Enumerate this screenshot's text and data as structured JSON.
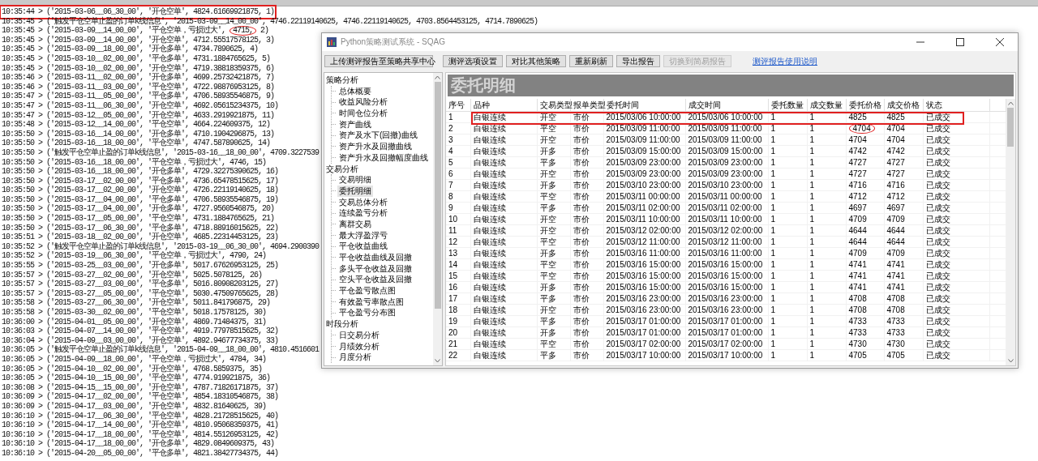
{
  "log_panel": {
    "lines": [
      {
        "text": "10:35:44 > ('2015-03-06__06_30_00', '开仓空单', 4824.61669921875, 1)",
        "highlighted": true
      },
      {
        "text": "10:35:45 > ('触发平仓空单止盈的订单k线信息', '2015-03-09__14_00_00', 4746.22119140625, 4746.22119140625, 4703.8564453125, 4714.7890625)",
        "highlighted": false
      },
      {
        "text": "10:35:45 > ('2015-03-09__14_00_00', '平仓空单，亏损过大', ",
        "circled": "4715,",
        "after": " 2)",
        "highlighted": false
      },
      {
        "text": "10:35:45 > ('2015-03-09__14_00_00', '开仓空单', 4712.55517578125, 3)",
        "highlighted": false
      },
      {
        "text": "10:35:45 > ('2015-03-09__18_00_00', '开仓多单', 4734.7890625, 4)",
        "highlighted": false
      },
      {
        "text": "10:35:45 > ('2015-03-10__02_00_00', '平仓多单', 4731.1884765625, 5)",
        "highlighted": false
      },
      {
        "text": "10:35:45 > ('2015-03-10__02_00_00', '开仓空单', 4719.38818359375, 6)",
        "highlighted": false
      },
      {
        "text": "10:35:46 > ('2015-03-11__02_00_00', '开仓多单', 4699.25732421875, 7)",
        "highlighted": false
      },
      {
        "text": "10:35:46 > ('2015-03-11__03_00_00', '平仓空单', 4722.98876953125, 8)",
        "highlighted": false
      },
      {
        "text": "10:35:47 > ('2015-03-11__05_00_00', '平仓多单', 4706.58935546875, 9)",
        "highlighted": false
      },
      {
        "text": "10:35:47 > ('2015-03-11__06_30_00', '开仓空单', 4692.05615234375, 10)",
        "highlighted": false
      },
      {
        "text": "10:35:47 > ('2015-03-12__05_00_00', '开仓空单', 4633.2919921875, 11)",
        "highlighted": false
      },
      {
        "text": "10:35:48 > ('2015-03-12__14_00_00', '平仓空单', 4664.224609375, 12)",
        "highlighted": false
      },
      {
        "text": "10:35:50 > ('2015-03-16__14_00_00', '开仓多单', 4710.1904296875, 13)",
        "highlighted": false
      },
      {
        "text": "10:35:50 > ('2015-03-16__18_00_00', '平仓空单', 4747.587890625, 14)",
        "highlighted": false
      },
      {
        "text": "10:35:50 > ('触发平仓空单止盈的订单k线信息', '2015-03-16__18_00_00', 4709.3227539",
        "highlighted": false
      },
      {
        "text": "10:35:50 > ('2015-03-16__18_00_00', '平仓空单，亏损过大', 4746, 15)",
        "highlighted": false
      },
      {
        "text": "10:35:50 > ('2015-03-16__18_00_00', '开仓多单', 4729.32275390625, 16)",
        "highlighted": false
      },
      {
        "text": "10:35:50 > ('2015-03-17__02_00_00', '平仓多单', 4736.65478515625, 17)",
        "highlighted": false
      },
      {
        "text": "10:35:50 > ('2015-03-17__02_00_00', '开仓空单', 4726.22119140625, 18)",
        "highlighted": false
      },
      {
        "text": "10:35:50 > ('2015-03-17__04_00_00', '平仓多单', 4706.58935546875, 19)",
        "highlighted": false
      },
      {
        "text": "10:35:50 > ('2015-03-17__04_00_00', '开仓多单', 4727.9560546875, 20)",
        "highlighted": false
      },
      {
        "text": "10:35:50 > ('2015-03-17__05_00_00', '平仓空单', 4731.1884765625, 21)",
        "highlighted": false
      },
      {
        "text": "10:35:50 > ('2015-03-17__06_30_00', '平仓多单', 4718.88916015625, 22)",
        "highlighted": false
      },
      {
        "text": "10:35:51 > ('2015-03-18__02_00_00', '开仓空单', 4685.22314453125, 23)",
        "highlighted": false
      },
      {
        "text": "10:35:52 > ('触发平仓空单止盈的订单k线信息', '2015-03-19__06_30_00', 4694.2900390",
        "highlighted": false
      },
      {
        "text": "10:35:52 > ('2015-03-19__06_30_00', '平仓空单，亏损过大', 4790, 24)",
        "highlighted": false
      },
      {
        "text": "10:35:55 > ('2015-03-25__03_00_00', '开仓多单', 5017.67626953125, 25)",
        "highlighted": false
      },
      {
        "text": "10:35:57 > ('2015-03-27__02_00_00', '开仓空单', 5025.5078125, 26)",
        "highlighted": false
      },
      {
        "text": "10:35:57 > ('2015-03-27__03_00_00', '平仓多单', 5016.80908203125, 27)",
        "highlighted": false
      },
      {
        "text": "10:35:57 > ('2015-03-27__05_00_00', '平仓空单', 5030.47509765625, 28)",
        "highlighted": false
      },
      {
        "text": "10:35:58 > ('2015-03-27__06_30_00', '开仓空单', 5011.841796875, 29)",
        "highlighted": false
      },
      {
        "text": "10:35:58 > ('2015-03-30__02_00_00', '平仓空单', 5018.17578125, 30)",
        "highlighted": false
      },
      {
        "text": "10:36:00 > ('2015-04-01__05_00_00', '开仓空单', 4869.71484375, 31)",
        "highlighted": false
      },
      {
        "text": "10:36:03 > ('2015-04-07__14_00_00', '平仓空单', 4919.77978515625, 32)",
        "highlighted": false
      },
      {
        "text": "10:36:04 > ('2015-04-09__03_00_00', '开仓空单', 4892.94677734375, 33)",
        "highlighted": false
      },
      {
        "text": "10:36:05 > ('触发平仓空单止盈的订单k线信息', '2015-04-09__18_00_00', 4810.4516601",
        "highlighted": false
      },
      {
        "text": "10:36:05 > ('2015-04-09__18_00_00', '平仓空单，亏损过大', 4784, 34)",
        "highlighted": false
      },
      {
        "text": "10:36:05 > ('2015-04-10__02_00_00', '开仓空单', 4768.5859375, 35)",
        "highlighted": false
      },
      {
        "text": "10:36:05 > ('2015-04-10__15_00_00', '平仓空单', 4774.919921875, 36)",
        "highlighted": false
      },
      {
        "text": "10:36:08 > ('2015-04-15__15_00_00', '开仓空单', 4787.71826171875, 37)",
        "highlighted": false
      },
      {
        "text": "10:36:09 > ('2015-04-17__02_00_00', '平仓空单', 4854.18310546875, 38)",
        "highlighted": false
      },
      {
        "text": "10:36:09 > ('2015-04-17__03_00_00', '开仓空单', 4832.81640625, 39)",
        "highlighted": false
      },
      {
        "text": "10:36:10 > ('2015-04-17__06_30_00', '平仓空单', 4828.21728515625, 40)",
        "highlighted": false
      },
      {
        "text": "10:36:10 > ('2015-04-17__14_00_00', '开仓空单', 4810.95068359375, 41)",
        "highlighted": false
      },
      {
        "text": "10:36:10 > ('2015-04-17__18_00_00', '平仓空单', 4814.55126953125, 42)",
        "highlighted": false
      },
      {
        "text": "10:36:10 > ('2015-04-17__18_00_00', '开仓多单', 4829.0849609375, 43)",
        "highlighted": false
      },
      {
        "text": "10:36:10 > ('2015-04-20__05_00_00', '平仓多单', 4821.38427734375, 44)",
        "highlighted": false
      }
    ]
  },
  "window": {
    "title": "Python策略测试系统 - SQAG",
    "toolbar": {
      "buttons": [
        {
          "label": "上传测评报告至策略共享中心",
          "disabled": false
        },
        {
          "label": "测评选项设置",
          "disabled": false
        },
        {
          "label": "对比其他策略",
          "disabled": false
        },
        {
          "label": "重新刷新",
          "disabled": false
        },
        {
          "label": "导出报告",
          "disabled": false
        },
        {
          "label": "切换到简易报告",
          "disabled": true
        }
      ],
      "link": "测评报告使用说明"
    },
    "sidebar": {
      "groups": [
        {
          "label": "策略分析",
          "children": [
            {
              "label": "总体概要",
              "selected": false
            },
            {
              "label": "收益风险分析",
              "selected": false
            },
            {
              "label": "时间仓位分析",
              "selected": false
            },
            {
              "label": "资产曲线",
              "selected": false
            },
            {
              "label": "资产及水下(回撤)曲线",
              "selected": false
            },
            {
              "label": "资产升水及回撤曲线",
              "selected": false
            },
            {
              "label": "资产升水及回撤幅度曲线",
              "selected": false
            }
          ]
        },
        {
          "label": "交易分析",
          "children": [
            {
              "label": "交易明细",
              "selected": false
            },
            {
              "label": "委托明细",
              "selected": true
            },
            {
              "label": "交易总体分析",
              "selected": false
            },
            {
              "label": "连续盈亏分析",
              "selected": false
            },
            {
              "label": "离群交易",
              "selected": false
            },
            {
              "label": "最大浮盈浮亏",
              "selected": false
            },
            {
              "label": "平仓收益曲线",
              "selected": false
            },
            {
              "label": "平仓收益曲线及回撤",
              "selected": false
            },
            {
              "label": "多头平仓收益及回撤",
              "selected": false
            },
            {
              "label": "空头平仓收益及回撤",
              "selected": false
            },
            {
              "label": "平仓盈亏散点图",
              "selected": false
            },
            {
              "label": "有效盈亏率散点图",
              "selected": false
            },
            {
              "label": "平仓盈亏分布图",
              "selected": false
            }
          ]
        },
        {
          "label": "时段分析",
          "children": [
            {
              "label": "日交易分析",
              "selected": false
            },
            {
              "label": "月绩效分析",
              "selected": false
            },
            {
              "label": "月度分析",
              "selected": false
            }
          ]
        }
      ]
    },
    "panel": {
      "heading": "委托明细",
      "table": {
        "columns": [
          "序号",
          "品种",
          "交易类型",
          "报单类型",
          "委托时间",
          "成交时间",
          "委托数量",
          "成交数量",
          "委托价格",
          "成交价格",
          "状态"
        ],
        "rows": [
          {
            "cells": [
              "1",
              "白银连续",
              "开空",
              "市价",
              "2015/03/06 10:00:00",
              "2015/03/06 10:00:00",
              "1",
              "1",
              "4825",
              "4825",
              "已成交"
            ],
            "highlighted": true
          },
          {
            "cells": [
              "2",
              "白银连续",
              "平空",
              "市价",
              "2015/03/09 11:00:00",
              "2015/03/09 11:00:00",
              "1",
              "1",
              {
                "text": "4704",
                "circled": true
              },
              "4704",
              "已成交"
            ],
            "highlighted": false
          },
          {
            "cells": [
              "3",
              "白银连续",
              "开空",
              "市价",
              "2015/03/09 11:00:00",
              "2015/03/09 11:00:00",
              "1",
              "1",
              "4704",
              "4704",
              "已成交"
            ],
            "highlighted": false
          },
          {
            "cells": [
              "4",
              "白银连续",
              "开多",
              "市价",
              "2015/03/09 15:00:00",
              "2015/03/09 15:00:00",
              "1",
              "1",
              "4742",
              "4742",
              "已成交"
            ],
            "highlighted": false
          },
          {
            "cells": [
              "5",
              "白银连续",
              "平多",
              "市价",
              "2015/03/09 23:00:00",
              "2015/03/09 23:00:00",
              "1",
              "1",
              "4727",
              "4727",
              "已成交"
            ],
            "highlighted": false
          },
          {
            "cells": [
              "6",
              "白银连续",
              "开空",
              "市价",
              "2015/03/09 23:00:00",
              "2015/03/09 23:00:00",
              "1",
              "1",
              "4727",
              "4727",
              "已成交"
            ],
            "highlighted": false
          },
          {
            "cells": [
              "7",
              "白银连续",
              "开多",
              "市价",
              "2015/03/10 23:00:00",
              "2015/03/10 23:00:00",
              "1",
              "1",
              "4716",
              "4716",
              "已成交"
            ],
            "highlighted": false
          },
          {
            "cells": [
              "8",
              "白银连续",
              "平空",
              "市价",
              "2015/03/11 00:00:00",
              "2015/03/11 00:00:00",
              "1",
              "1",
              "4712",
              "4712",
              "已成交"
            ],
            "highlighted": false
          },
          {
            "cells": [
              "9",
              "白银连续",
              "平多",
              "市价",
              "2015/03/11 02:00:00",
              "2015/03/11 02:00:00",
              "1",
              "1",
              "4697",
              "4697",
              "已成交"
            ],
            "highlighted": false
          },
          {
            "cells": [
              "10",
              "白银连续",
              "开空",
              "市价",
              "2015/03/11 10:00:00",
              "2015/03/11 10:00:00",
              "1",
              "1",
              "4709",
              "4709",
              "已成交"
            ],
            "highlighted": false
          },
          {
            "cells": [
              "11",
              "白银连续",
              "开空",
              "市价",
              "2015/03/12 02:00:00",
              "2015/03/12 02:00:00",
              "1",
              "1",
              "4644",
              "4644",
              "已成交"
            ],
            "highlighted": false
          },
          {
            "cells": [
              "12",
              "白银连续",
              "平空",
              "市价",
              "2015/03/12 11:00:00",
              "2015/03/12 11:00:00",
              "1",
              "1",
              "4644",
              "4644",
              "已成交"
            ],
            "highlighted": false
          },
          {
            "cells": [
              "13",
              "白银连续",
              "开多",
              "市价",
              "2015/03/16 11:00:00",
              "2015/03/16 11:00:00",
              "1",
              "1",
              "4709",
              "4709",
              "已成交"
            ],
            "highlighted": false
          },
          {
            "cells": [
              "14",
              "白银连续",
              "平空",
              "市价",
              "2015/03/16 15:00:00",
              "2015/03/16 15:00:00",
              "1",
              "1",
              "4741",
              "4741",
              "已成交"
            ],
            "highlighted": false
          },
          {
            "cells": [
              "15",
              "白银连续",
              "平空",
              "市价",
              "2015/03/16 15:00:00",
              "2015/03/16 15:00:00",
              "1",
              "1",
              "4741",
              "4741",
              "已成交"
            ],
            "highlighted": false
          },
          {
            "cells": [
              "16",
              "白银连续",
              "开多",
              "市价",
              "2015/03/16 15:00:00",
              "2015/03/16 15:00:00",
              "1",
              "1",
              "4741",
              "4741",
              "已成交"
            ],
            "highlighted": false
          },
          {
            "cells": [
              "17",
              "白银连续",
              "平多",
              "市价",
              "2015/03/16 23:00:00",
              "2015/03/16 23:00:00",
              "1",
              "1",
              "4708",
              "4708",
              "已成交"
            ],
            "highlighted": false
          },
          {
            "cells": [
              "18",
              "白银连续",
              "开空",
              "市价",
              "2015/03/16 23:00:00",
              "2015/03/16 23:00:00",
              "1",
              "1",
              "4708",
              "4708",
              "已成交"
            ],
            "highlighted": false
          },
          {
            "cells": [
              "19",
              "白银连续",
              "平多",
              "市价",
              "2015/03/17 01:00:00",
              "2015/03/17 01:00:00",
              "1",
              "1",
              "4733",
              "4733",
              "已成交"
            ],
            "highlighted": false
          },
          {
            "cells": [
              "20",
              "白银连续",
              "开多",
              "市价",
              "2015/03/17 01:00:00",
              "2015/03/17 01:00:00",
              "1",
              "1",
              "4733",
              "4733",
              "已成交"
            ],
            "highlighted": false
          },
          {
            "cells": [
              "21",
              "白银连续",
              "平空",
              "市价",
              "2015/03/17 02:00:00",
              "2015/03/17 02:00:00",
              "1",
              "1",
              "4730",
              "4730",
              "已成交"
            ],
            "highlighted": false
          },
          {
            "cells": [
              "22",
              "白银连续",
              "平多",
              "市价",
              "2015/03/17 10:00:00",
              "2015/03/17 10:00:00",
              "1",
              "1",
              "4705",
              "4705",
              "已成交"
            ],
            "highlighted": false
          }
        ]
      }
    }
  }
}
